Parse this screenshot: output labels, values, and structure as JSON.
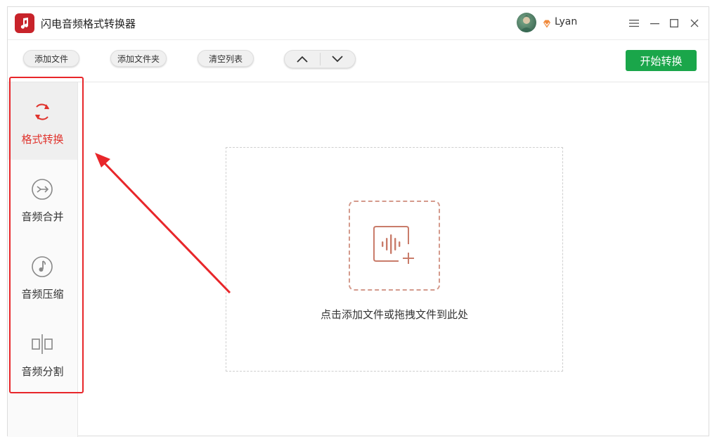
{
  "titlebar": {
    "app_title": "闪电音频格式转换器",
    "username": "Lyan",
    "icons": [
      "music-note-logo-icon",
      "vip-diamond-icon",
      "menu-icon",
      "minimize-icon",
      "maximize-icon",
      "close-icon"
    ]
  },
  "toolbar": {
    "add_file_label": "添加文件",
    "add_folder_label": "添加文件夹",
    "clear_list_label": "清空列表",
    "move_up_icon": "chevron-up-icon",
    "move_down_icon": "chevron-down-icon",
    "start_label": "开始转换",
    "start_color": "#1aa64a"
  },
  "sidebar": {
    "items": [
      {
        "label": "格式转换",
        "icon": "refresh-icon",
        "active": true
      },
      {
        "label": "音频合并",
        "icon": "merge-icon",
        "active": false
      },
      {
        "label": "音频压缩",
        "icon": "music-note-icon",
        "active": false
      },
      {
        "label": "音频分割",
        "icon": "split-icon",
        "active": false
      }
    ],
    "active_color": "#e0332d"
  },
  "main": {
    "drop_text": "点击添加文件或拖拽文件到此处",
    "drop_icon": "audio-add-icon"
  },
  "annotation": {
    "highlight_color": "#e8262a"
  }
}
